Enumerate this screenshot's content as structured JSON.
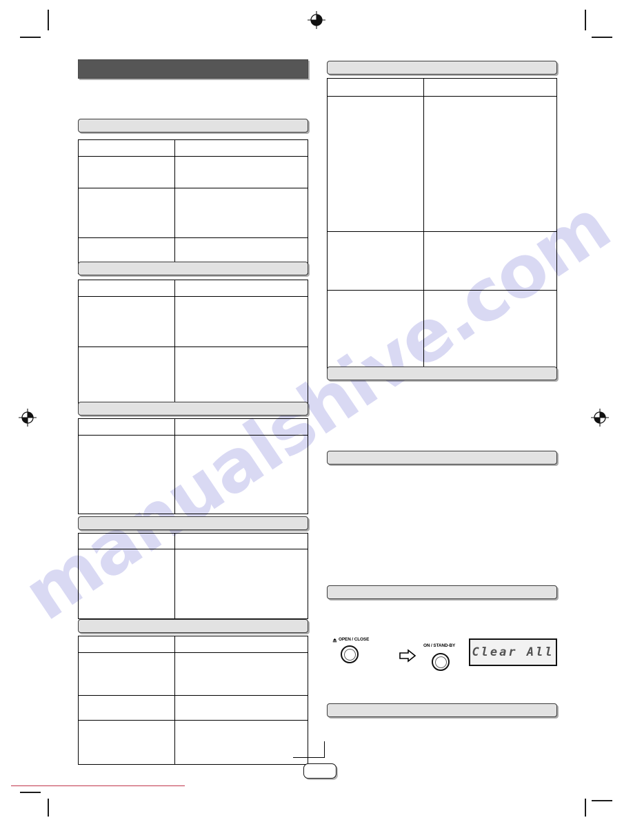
{
  "document": {
    "title_banner": "",
    "page_number": "",
    "watermark": "manualshive.com"
  },
  "colors": {
    "title_banner_bg": "#565656",
    "section_bar_bg": "#e2e2e2",
    "section_bar_border": "#3b3b3b",
    "table_border": "#000000",
    "watermark": "#9d9de0",
    "footer_rule": "#c0344a",
    "lcd_text": "#3d3d3d"
  },
  "left_column": {
    "sections": [
      {
        "bar_label": "",
        "table": {
          "headers": [
            "",
            ""
          ],
          "rows": [
            [
              "",
              ""
            ],
            [
              "",
              ""
            ],
            [
              "",
              ""
            ]
          ]
        }
      },
      {
        "bar_label": "",
        "table": {
          "headers": [
            "",
            ""
          ],
          "rows": [
            [
              "",
              ""
            ],
            [
              "",
              ""
            ]
          ]
        }
      },
      {
        "bar_label": "",
        "table": {
          "headers": [
            "",
            ""
          ],
          "rows": [
            [
              "",
              ""
            ]
          ]
        }
      },
      {
        "bar_label": "",
        "table": {
          "headers": [
            "",
            ""
          ],
          "rows": [
            [
              "",
              ""
            ]
          ]
        }
      },
      {
        "bar_label": "",
        "table": {
          "headers": [
            "",
            ""
          ],
          "rows": [
            [
              "",
              ""
            ],
            [
              "",
              ""
            ],
            [
              "",
              ""
            ]
          ]
        }
      }
    ]
  },
  "right_column": {
    "sections": [
      {
        "bar_label": "",
        "table": {
          "headers": [
            "",
            ""
          ],
          "rows": [
            [
              "",
              ""
            ],
            [
              "",
              ""
            ],
            [
              "",
              ""
            ]
          ]
        }
      },
      {
        "bar_label": "",
        "body": ""
      },
      {
        "bar_label": "",
        "body": ""
      },
      {
        "bar_label": "",
        "body": ""
      },
      {
        "bar_label": "",
        "body": ""
      }
    ],
    "illustration": {
      "open_close_label": "OPEN / CLOSE",
      "open_close_icon": "eject-triangle",
      "arrow_icon": "right-arrow",
      "standby_label": "ON / STAND-BY",
      "lcd_text": "Clear All"
    }
  }
}
